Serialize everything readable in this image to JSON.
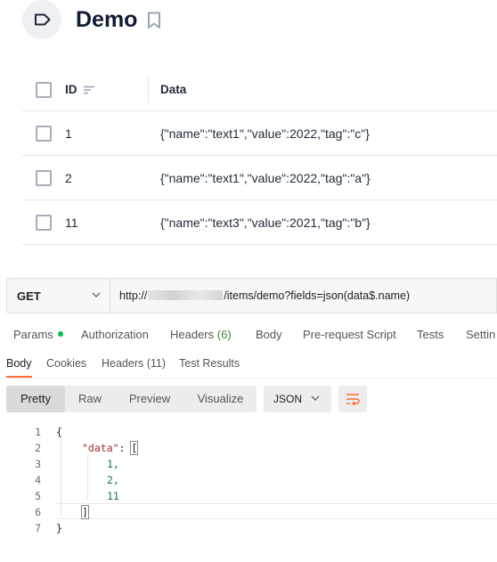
{
  "header": {
    "title": "Demo"
  },
  "table": {
    "columns": {
      "id": "ID",
      "data": "Data"
    },
    "rows": [
      {
        "id": "1",
        "data": "{\"name\":\"text1\",\"value\":2022,\"tag\":\"c\"}"
      },
      {
        "id": "2",
        "data": "{\"name\":\"text1\",\"value\":2022,\"tag\":\"a\"}"
      },
      {
        "id": "11",
        "data": "{\"name\":\"text3\",\"value\":2021,\"tag\":\"b\"}"
      }
    ]
  },
  "request": {
    "method": "GET",
    "url_prefix": "http://",
    "url_suffix": "/items/demo?fields=json(data$.name)",
    "tabs": {
      "params": "Params",
      "authorization": "Authorization",
      "headers": "Headers",
      "headers_count": "(6)",
      "body": "Body",
      "prerequest": "Pre-request Script",
      "tests": "Tests",
      "settings": "Settin"
    }
  },
  "response": {
    "tabs": {
      "body": "Body",
      "cookies": "Cookies",
      "headers": "Headers (11)",
      "test_results": "Test Results"
    },
    "views": {
      "pretty": "Pretty",
      "raw": "Raw",
      "preview": "Preview",
      "visualize": "Visualize"
    },
    "format": "JSON",
    "code": {
      "line_numbers": [
        "1",
        "2",
        "3",
        "4",
        "5",
        "6",
        "7"
      ],
      "open_brace": "{",
      "key": "\"data\"",
      "colon": ": ",
      "open_bracket": "[",
      "values": [
        "1,",
        "2,",
        "11"
      ],
      "close_bracket": "]",
      "close_brace": "}"
    }
  },
  "colors": {
    "accent": "#ff6c37",
    "params_dot": "#0cbb52",
    "title": "#111b35"
  }
}
